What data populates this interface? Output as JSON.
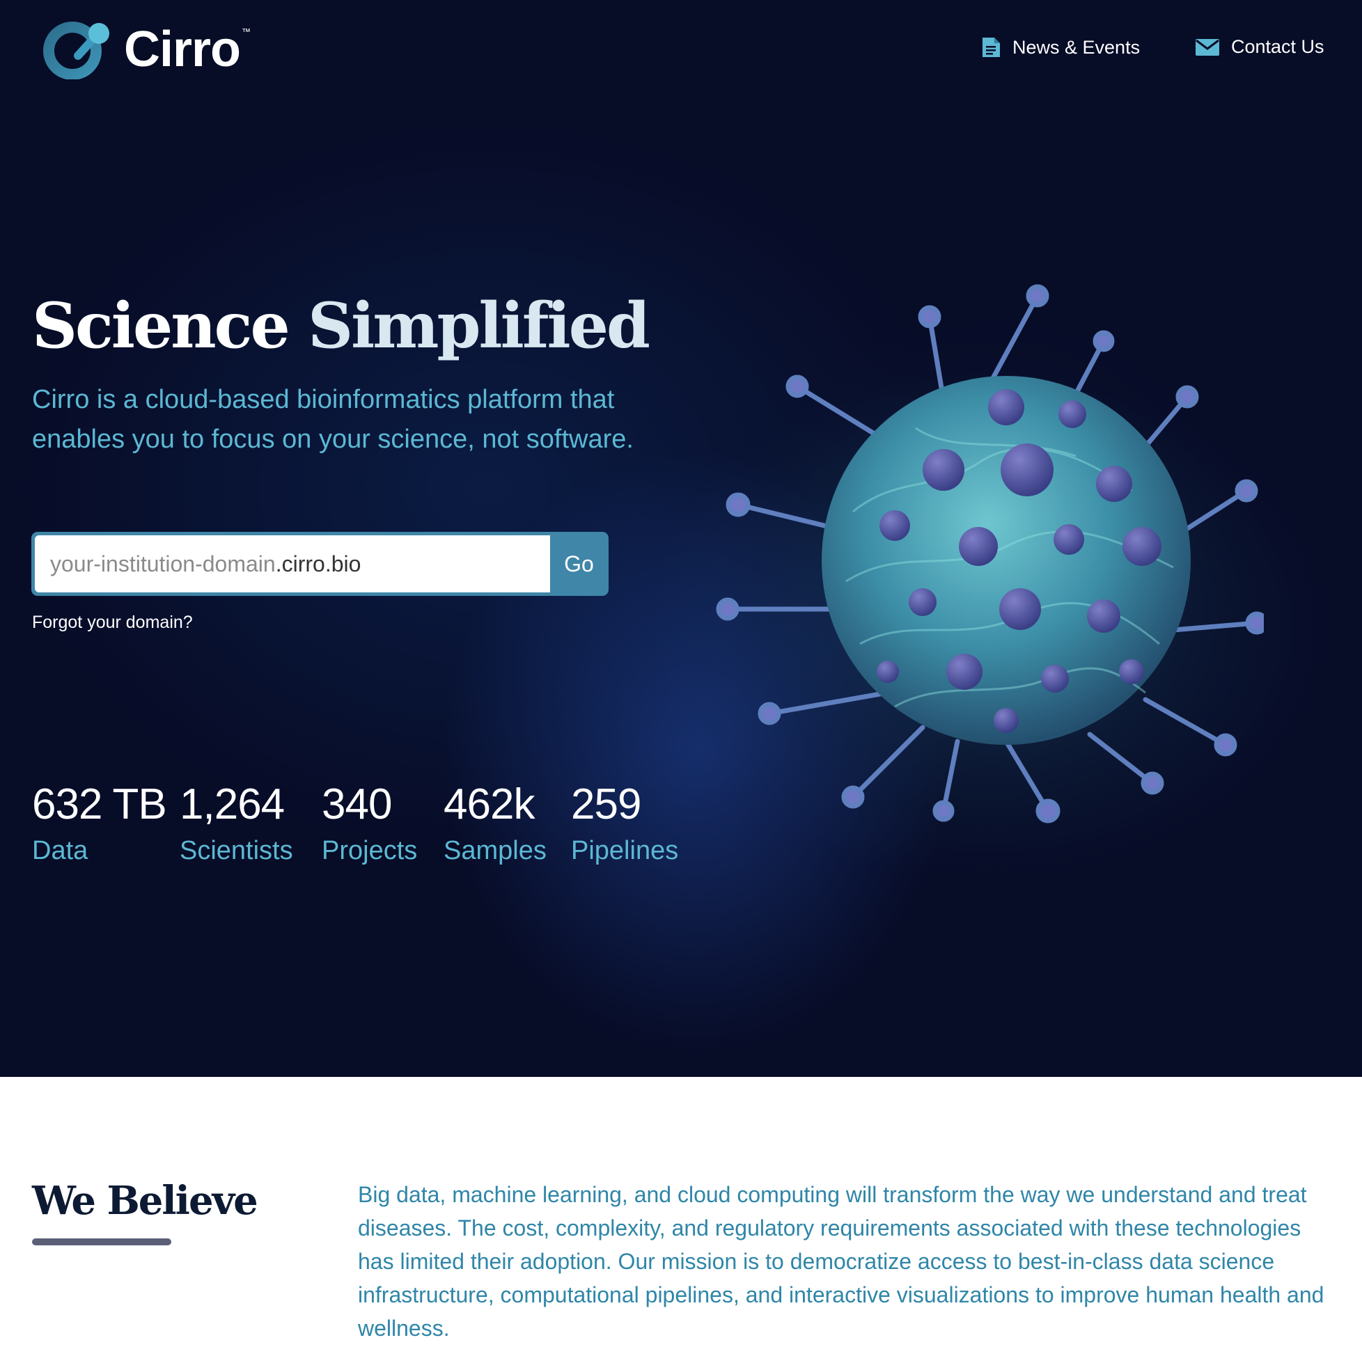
{
  "header": {
    "logo_text": "Cirro",
    "logo_tm": "™",
    "nav": {
      "news_label": "News & Events",
      "contact_label": "Contact Us"
    }
  },
  "hero": {
    "title_word1": "Science",
    "title_word2": "Simplified",
    "intro": "Cirro is a cloud-based bioinformatics platform that enables you to focus on your science, not software.",
    "domain_input": {
      "placeholder": "your-institution-domain",
      "suffix": ".cirro.bio",
      "value": ""
    },
    "go_label": "Go",
    "forgot_label": "Forgot your domain?",
    "stats": [
      {
        "value": "632 TB",
        "label": "Data"
      },
      {
        "value": "1,264",
        "label": "Scientists"
      },
      {
        "value": "340",
        "label": "Projects"
      },
      {
        "value": "462k",
        "label": "Samples"
      },
      {
        "value": "259",
        "label": "Pipelines"
      }
    ]
  },
  "believe": {
    "heading": "We Believe",
    "text": "Big data, machine learning, and cloud computing will transform the way we understand and treat diseases. The cost, complexity, and regulatory requirements associated with these technologies has limited their adoption. Our mission is to democratize access to best-in-class data science infrastructure, computational pipelines, and interactive visualizations to improve human health and wellness."
  },
  "colors": {
    "hero_bg": "#070c27",
    "accent": "#5cb8d3",
    "button": "#3f86a8",
    "believe_text": "#2f86a8"
  },
  "icons": {
    "news": "document-icon",
    "contact": "envelope-icon",
    "logo": "cirro-logo-icon",
    "hero_image": "cell-illustration"
  }
}
